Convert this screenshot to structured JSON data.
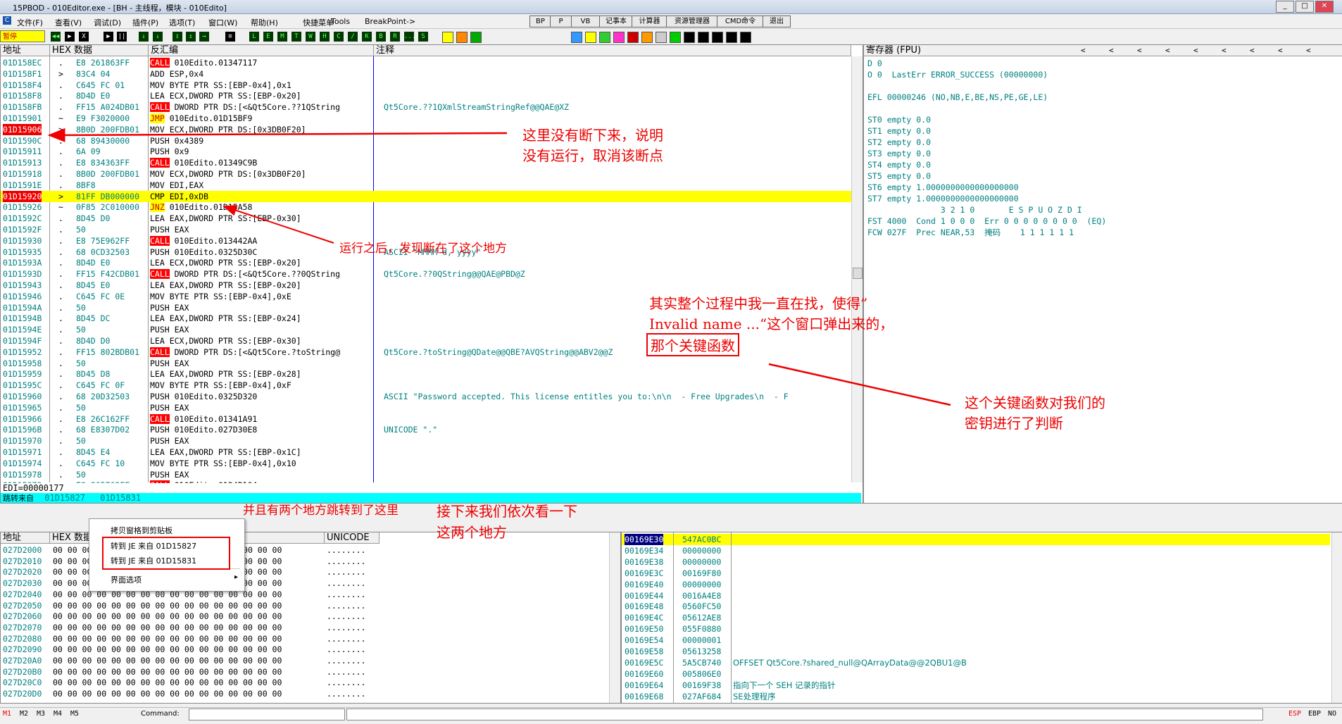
{
  "window": {
    "title": "15PBOD - 010Editor.exe - [BH - 主线程，模块 - 010Edito]"
  },
  "menu": [
    "文件(F)",
    "查看(V)",
    "调试(D)",
    "插件(P)",
    "选项(T)",
    "窗口(W)",
    "帮助(H)",
    "快捷菜单",
    "Tools",
    "BreakPoint->"
  ],
  "top_buttons": [
    "BP",
    "P",
    "VB",
    "记事本",
    "计算器",
    "资源管理器",
    "CMD命令",
    "退出"
  ],
  "status": {
    "paused": "暂停"
  },
  "toolbar_letters": [
    "L",
    "E",
    "M",
    "T",
    "W",
    "H",
    "C",
    "/",
    "K",
    "B",
    "R",
    "...",
    "S"
  ],
  "cpu": {
    "headers": {
      "addr": "地址",
      "hex": "HEX 数据",
      "disasm": "反汇编",
      "comment": "注释"
    },
    "rows": [
      {
        "addr": "01D158EC",
        "mark": ".",
        "hex": "E8 261863FF",
        "op": "CALL",
        "arg": " 010Edito.01347117",
        "comment": ""
      },
      {
        "addr": "01D158F1",
        "mark": ">",
        "hex": "83C4 04",
        "op": "",
        "arg": "ADD ESP,0x4",
        "comment": ""
      },
      {
        "addr": "01D158F4",
        "mark": ".",
        "hex": "C645 FC 01",
        "op": "",
        "arg": "MOV BYTE PTR SS:[EBP-0x4],0x1",
        "comment": ""
      },
      {
        "addr": "01D158F8",
        "mark": ".",
        "hex": "8D4D E0",
        "op": "",
        "arg": "LEA ECX,DWORD PTR SS:[EBP-0x20]",
        "comment": ""
      },
      {
        "addr": "01D158FB",
        "mark": ".",
        "hex": "FF15 A024DB01",
        "op": "CALL",
        "arg": " DWORD PTR DS:[<&Qt5Core.??1QString",
        "comment": "Qt5Core.??1QXmlStreamStringRef@@QAE@XZ"
      },
      {
        "addr": "01D15901",
        "mark": "~",
        "hex": "E9 F3020000",
        "op": "JMP",
        "arg": " 010Edito.01D15BF9",
        "comment": ""
      },
      {
        "addr": "01D15906",
        "mark": ">",
        "hex": "8B0D 200FDB01",
        "op": "",
        "arg": "MOV ECX,DWORD PTR DS:[0x3DB0F20]",
        "comment": ""
      },
      {
        "addr": "01D1590C",
        "mark": ".",
        "hex": "68 89430000",
        "op": "",
        "arg": "PUSH 0x4389",
        "comment": ""
      },
      {
        "addr": "01D15911",
        "mark": ".",
        "hex": "6A 09",
        "op": "",
        "arg": "PUSH 0x9",
        "comment": ""
      },
      {
        "addr": "01D15913",
        "mark": ".",
        "hex": "E8 834363FF",
        "op": "CALL",
        "arg": " 010Edito.01349C9B",
        "comment": ""
      },
      {
        "addr": "01D15918",
        "mark": ".",
        "hex": "8B0D 200FDB01",
        "op": "",
        "arg": "MOV ECX,DWORD PTR DS:[0x3DB0F20]",
        "comment": ""
      },
      {
        "addr": "01D1591E",
        "mark": ".",
        "hex": "8BF8",
        "op": "",
        "arg": "MOV EDI,EAX",
        "comment": ""
      },
      {
        "addr": "01D15920",
        "mark": ">",
        "hex": "81FF DB000000",
        "op": "",
        "arg": "CMP EDI,0xDB",
        "comment": ""
      },
      {
        "addr": "01D15926",
        "mark": "~",
        "hex": "0F85 2C010000",
        "op": "JNZ",
        "arg": " 010Edito.01D15A58",
        "comment": ""
      },
      {
        "addr": "01D1592C",
        "mark": ".",
        "hex": "8D45 D0",
        "op": "",
        "arg": "LEA EAX,DWORD PTR SS:[EBP-0x30]",
        "comment": ""
      },
      {
        "addr": "01D1592F",
        "mark": ".",
        "hex": "50",
        "op": "",
        "arg": "PUSH EAX",
        "comment": ""
      },
      {
        "addr": "01D15930",
        "mark": ".",
        "hex": "E8 75E962FF",
        "op": "CALL",
        "arg": " 010Edito.013442AA",
        "comment": ""
      },
      {
        "addr": "01D15935",
        "mark": ".",
        "hex": "68 0CD32503",
        "op": "",
        "arg": "PUSH 010Edito.0325D30C",
        "comment": "ASCII \"MMMM d, yyyy\""
      },
      {
        "addr": "01D1593A",
        "mark": ".",
        "hex": "8D4D E0",
        "op": "",
        "arg": "LEA ECX,DWORD PTR SS:[EBP-0x20]",
        "comment": ""
      },
      {
        "addr": "01D1593D",
        "mark": ".",
        "hex": "FF15 F42CDB01",
        "op": "CALL",
        "arg": " DWORD PTR DS:[<&Qt5Core.??0QString",
        "comment": "Qt5Core.??0QString@@QAE@PBD@Z"
      },
      {
        "addr": "01D15943",
        "mark": ".",
        "hex": "8D45 E0",
        "op": "",
        "arg": "LEA EAX,DWORD PTR SS:[EBP-0x20]",
        "comment": ""
      },
      {
        "addr": "01D15946",
        "mark": ".",
        "hex": "C645 FC 0E",
        "op": "",
        "arg": "MOV BYTE PTR SS:[EBP-0x4],0xE",
        "comment": ""
      },
      {
        "addr": "01D1594A",
        "mark": ".",
        "hex": "50",
        "op": "",
        "arg": "PUSH EAX",
        "comment": ""
      },
      {
        "addr": "01D1594B",
        "mark": ".",
        "hex": "8D45 DC",
        "op": "",
        "arg": "LEA EAX,DWORD PTR SS:[EBP-0x24]",
        "comment": ""
      },
      {
        "addr": "01D1594E",
        "mark": ".",
        "hex": "50",
        "op": "",
        "arg": "PUSH EAX",
        "comment": ""
      },
      {
        "addr": "01D1594F",
        "mark": ".",
        "hex": "8D4D D0",
        "op": "",
        "arg": "LEA ECX,DWORD PTR SS:[EBP-0x30]",
        "comment": ""
      },
      {
        "addr": "01D15952",
        "mark": ".",
        "hex": "FF15 802BDB01",
        "op": "CALL",
        "arg": " DWORD PTR DS:[<&Qt5Core.?toString@",
        "comment": "Qt5Core.?toString@QDate@@QBE?AVQString@@ABV2@@Z"
      },
      {
        "addr": "01D15958",
        "mark": ".",
        "hex": "50",
        "op": "",
        "arg": "PUSH EAX",
        "comment": ""
      },
      {
        "addr": "01D15959",
        "mark": ".",
        "hex": "8D45 D8",
        "op": "",
        "arg": "LEA EAX,DWORD PTR SS:[EBP-0x28]",
        "comment": ""
      },
      {
        "addr": "01D1595C",
        "mark": ".",
        "hex": "C645 FC 0F",
        "op": "",
        "arg": "MOV BYTE PTR SS:[EBP-0x4],0xF",
        "comment": ""
      },
      {
        "addr": "01D15960",
        "mark": ".",
        "hex": "68 20D32503",
        "op": "",
        "arg": "PUSH 010Edito.0325D320",
        "comment": "ASCII \"Password accepted. This license entitles you to:\\n\\n  - Free Upgrades\\n  - F"
      },
      {
        "addr": "01D15965",
        "mark": ".",
        "hex": "50",
        "op": "",
        "arg": "PUSH EAX",
        "comment": ""
      },
      {
        "addr": "01D15966",
        "mark": ".",
        "hex": "E8 26C162FF",
        "op": "CALL",
        "arg": " 010Edito.01341A91",
        "comment": ""
      },
      {
        "addr": "01D1596B",
        "mark": ".",
        "hex": "68 E8307D02",
        "op": "",
        "arg": "PUSH 010Edito.027D30E8",
        "comment": "UNICODE \".\""
      },
      {
        "addr": "01D15970",
        "mark": ".",
        "hex": "50",
        "op": "",
        "arg": "PUSH EAX",
        "comment": ""
      },
      {
        "addr": "01D15971",
        "mark": ".",
        "hex": "8D45 E4",
        "op": "",
        "arg": "LEA EAX,DWORD PTR SS:[EBP-0x1C]",
        "comment": ""
      },
      {
        "addr": "01D15974",
        "mark": ".",
        "hex": "C645 FC 10",
        "op": "",
        "arg": "MOV BYTE PTR SS:[EBP-0x4],0x10",
        "comment": ""
      },
      {
        "addr": "01D15978",
        "mark": ".",
        "hex": "50",
        "op": "",
        "arg": "PUSH EAX",
        "comment": ""
      },
      {
        "addr": "01D15979",
        "mark": ".",
        "hex": "E8 865763FF",
        "op": "CALL",
        "arg": " 010Edito.0134B104",
        "comment": ""
      }
    ],
    "info1": "EDI=00000177",
    "info2_label": "跳转来自",
    "info2_addr": "01D15827",
    "info2_addr2": "01D15831"
  },
  "registers": {
    "title": "寄存器 (FPU)",
    "lines": [
      "D 0",
      "O 0  LastErr ERROR_SUCCESS (00000000)",
      "",
      "EFL 00000246 (NO,NB,E,BE,NS,PE,GE,LE)",
      "",
      "ST0 empty 0.0",
      "ST1 empty 0.0",
      "ST2 empty 0.0",
      "ST3 empty 0.0",
      "ST4 empty 0.0",
      "ST5 empty 0.0",
      "ST6 empty 1.0000000000000000000",
      "ST7 empty 1.0000000000000000000",
      "               3 2 1 0       E S P U O Z D I",
      "FST 4000  Cond 1 0 0 0  Err 0 0 0 0 0 0 0 0  (EQ)",
      "FCW 027F  Prec NEAR,53  掩码    1 1 1 1 1 1"
    ]
  },
  "dump": {
    "headers": {
      "addr": "地址",
      "hex": "HEX 数据",
      "unicode": "UNICODE"
    },
    "rows": [
      "027D2000",
      "027D2010",
      "027D2020",
      "027D2030",
      "027D2040",
      "027D2050",
      "027D2060",
      "027D2070",
      "027D2080",
      "027D2090",
      "027D20A0",
      "027D20B0",
      "027D20C0",
      "027D20D0"
    ],
    "hexfill": "00 00 00 00 00 00 00 00 00 00 00 00 00 00 00 00",
    "unifill": "........"
  },
  "stack": {
    "rows": [
      {
        "a": "00169E30",
        "v": "547AC0BC",
        "c": ""
      },
      {
        "a": "00169E34",
        "v": "00000000",
        "c": ""
      },
      {
        "a": "00169E38",
        "v": "00000000",
        "c": ""
      },
      {
        "a": "00169E3C",
        "v": "00169F80",
        "c": ""
      },
      {
        "a": "00169E40",
        "v": "00000000",
        "c": ""
      },
      {
        "a": "00169E44",
        "v": "0016A4E8",
        "c": ""
      },
      {
        "a": "00169E48",
        "v": "0560FC50",
        "c": ""
      },
      {
        "a": "00169E4C",
        "v": "05612AE8",
        "c": ""
      },
      {
        "a": "00169E50",
        "v": "055F0880",
        "c": ""
      },
      {
        "a": "00169E54",
        "v": "00000001",
        "c": ""
      },
      {
        "a": "00169E58",
        "v": "05613258",
        "c": ""
      },
      {
        "a": "00169E5C",
        "v": "5A5CB740",
        "c": "OFFSET Qt5Core.?shared_null@QArrayData@@2QBU1@B"
      },
      {
        "a": "00169E60",
        "v": "005806E0",
        "c": ""
      },
      {
        "a": "00169E64",
        "v": "00169F38",
        "c": "指向下一个 SEH 记录的指针"
      },
      {
        "a": "00169E68",
        "v": "027AF684",
        "c": "SE处理程序"
      }
    ]
  },
  "context_menu": {
    "items": [
      "拷贝窗格到剪贴板",
      "转到 JE 来自 01D15827",
      "转到 JE 来自 01D15831",
      "界面选项"
    ]
  },
  "bottom": {
    "tabs": [
      "M1",
      "M2",
      "M3",
      "M4",
      "M5"
    ],
    "command_label": "Command:",
    "regs": [
      "ESP",
      "EBP",
      "NO"
    ]
  },
  "annotations": {
    "a1": "这里没有断下来，说明\n没有运行，取消该断点",
    "a2": "运行之后，发现断在了这个地方",
    "a3": "其实整个过程中我一直在找，使得”\nInvalid name ...“这个窗口弹出来的，",
    "a3b": "那个关键函数",
    "a4": "这个关键函数对我们的\n密钥进行了判断",
    "a5": "并且有两个地方跳转到了这里",
    "a6": "接下来我们依次看一下\n这两个地方"
  },
  "colors": {
    "accent_red": "#ff0000",
    "highlight_yellow": "#ffff00",
    "addr_teal": "#008080"
  }
}
